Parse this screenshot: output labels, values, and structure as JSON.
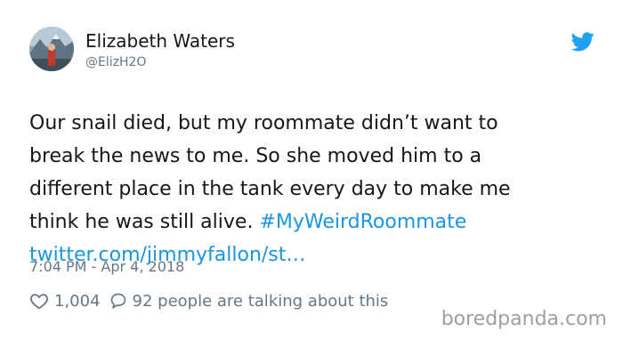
{
  "author": {
    "name": "Elizabeth Waters",
    "handle": "@ElizH2O"
  },
  "tweet": {
    "lines": [
      "Our snail died, but my roommate didn’t want to",
      "break the news to me. So she moved him to a",
      "different place in the tank every day to make me",
      "think he was still alive. "
    ],
    "hashtag": "#MyWeirdRoommate",
    "url": "twitter.com/jimmyfallon/st…",
    "timestamp": "7:04 PM - Apr 4, 2018"
  },
  "stats": {
    "likes": "1,004",
    "talking": "92 people are talking about this"
  },
  "watermark": "boredpanda.com",
  "colors": {
    "link": "#1b95e0",
    "secondary_text": "#657786",
    "twitter_bird": "#1da1f2"
  },
  "icons": [
    "avatar-photo",
    "twitter-bird-icon",
    "heart-icon",
    "reply-bubble-icon"
  ]
}
